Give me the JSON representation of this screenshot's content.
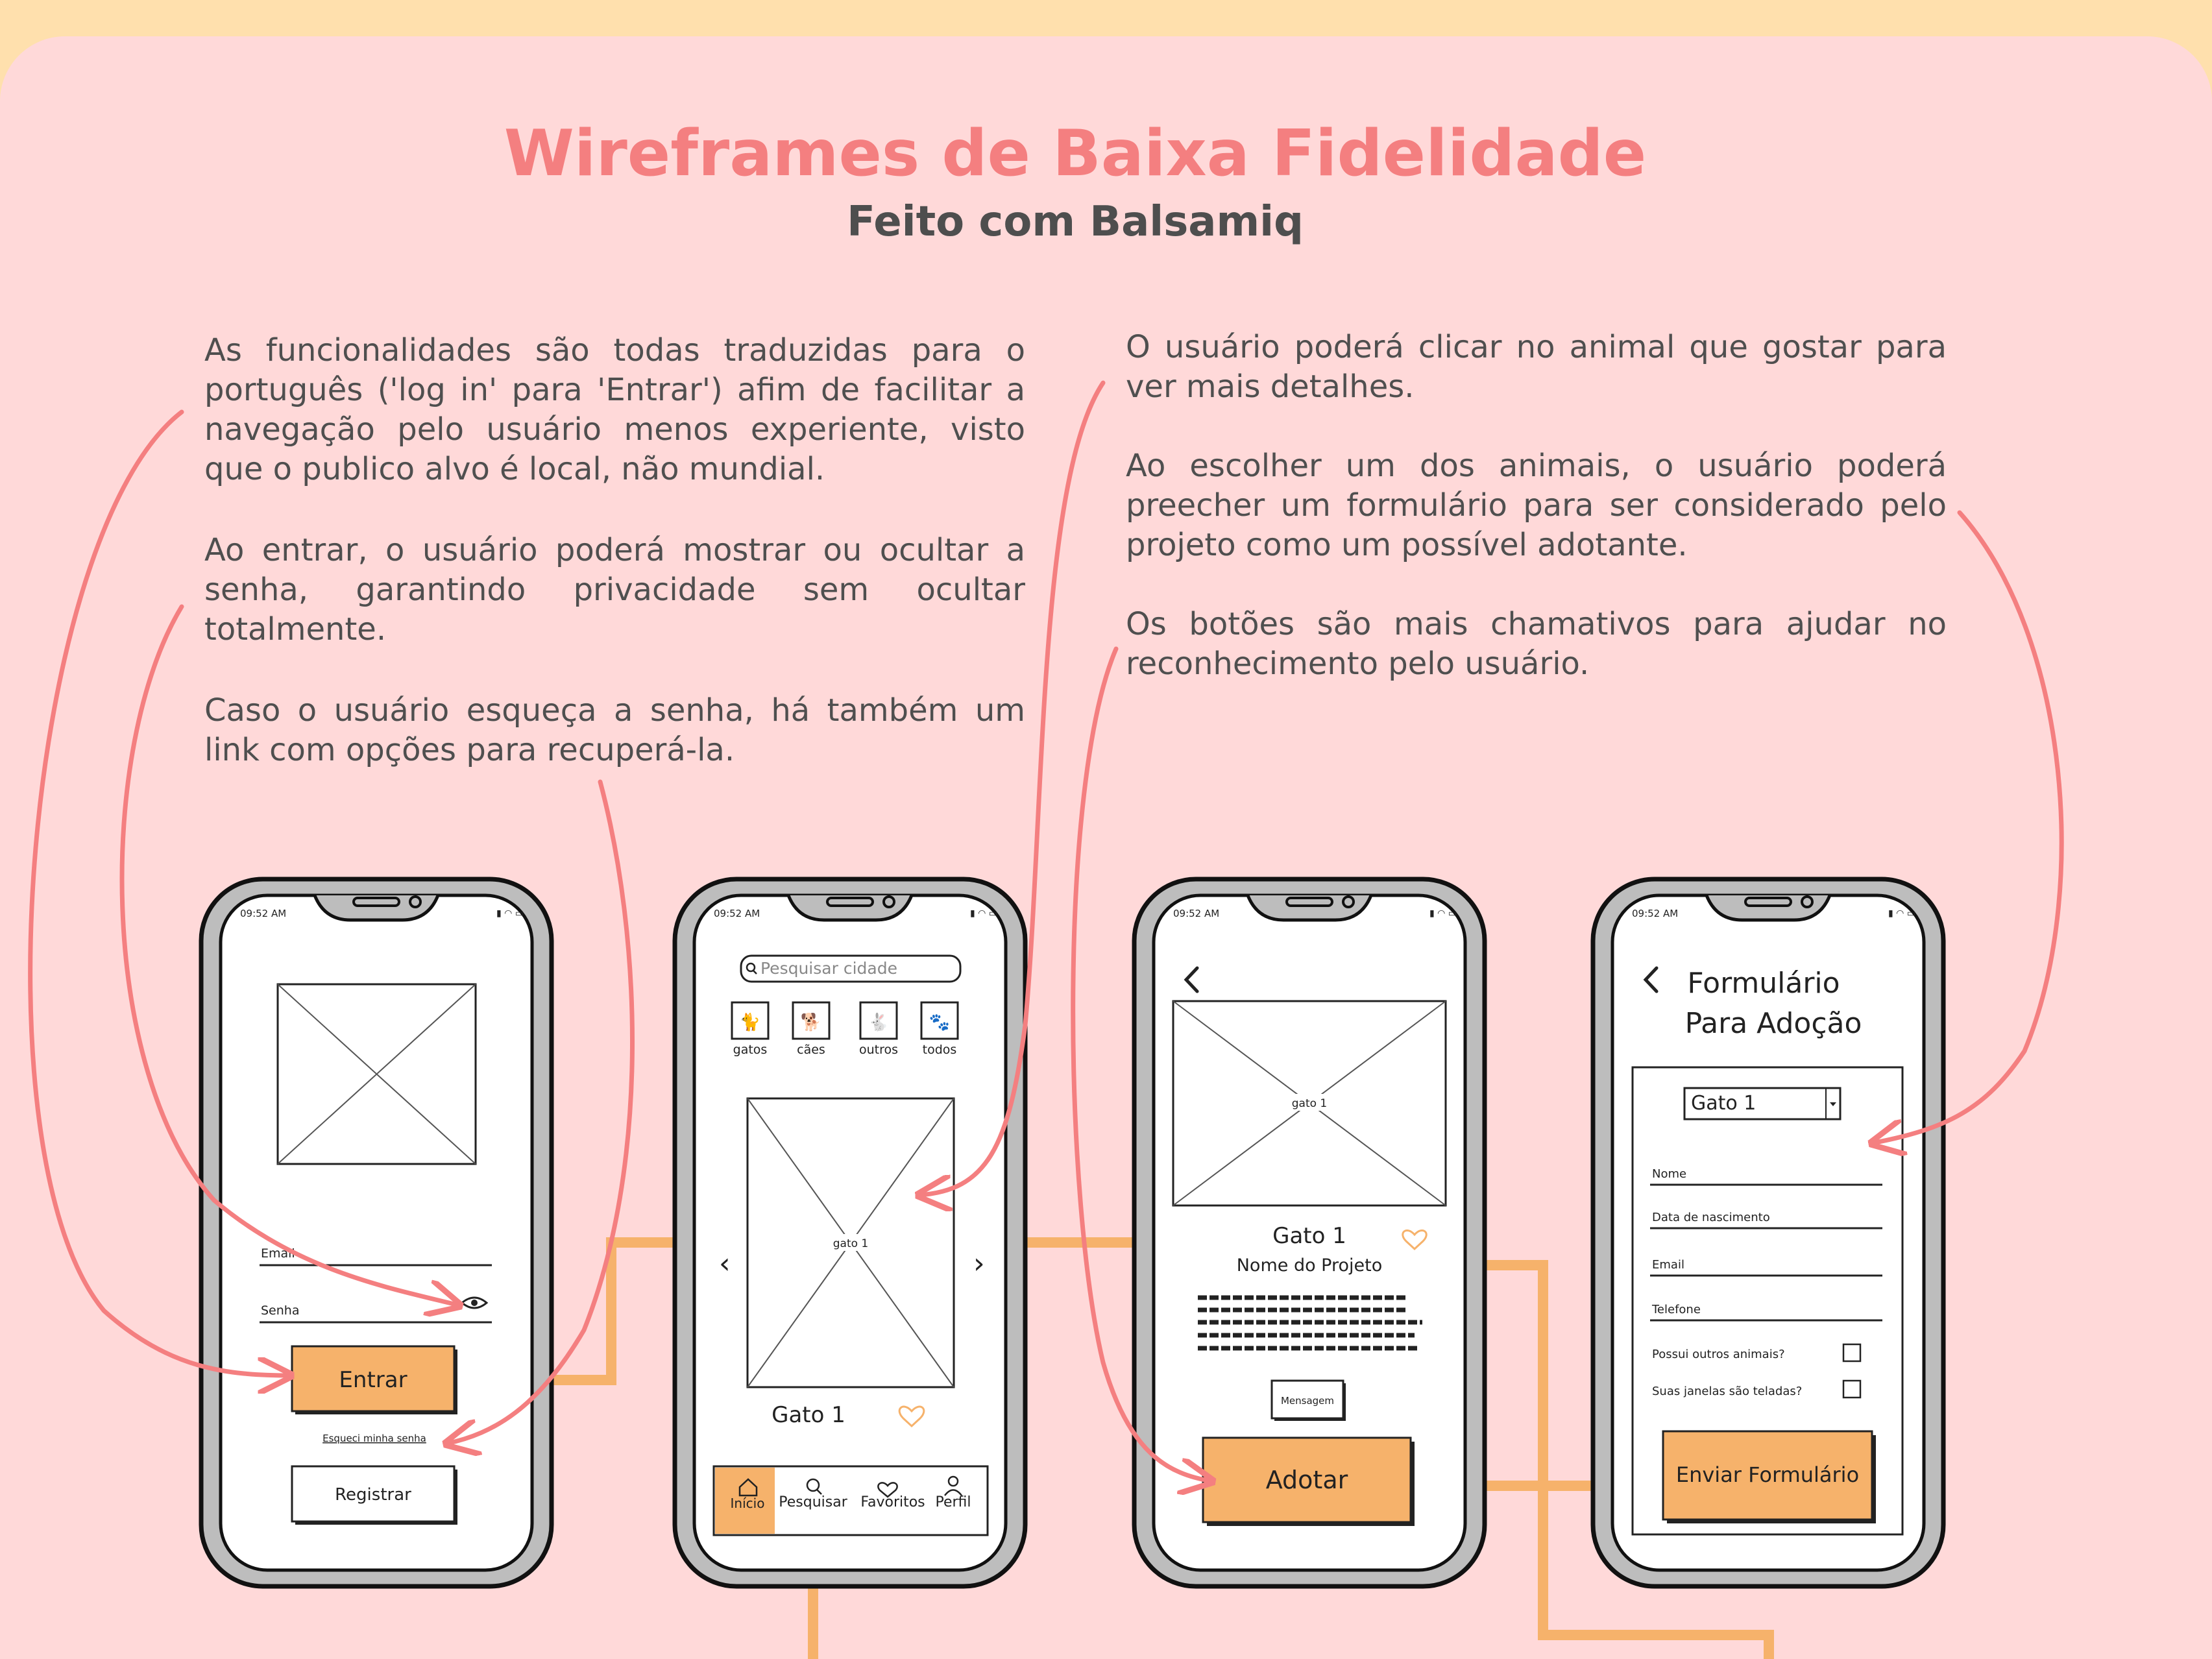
{
  "header": {
    "title": "Wireframes de Baixa Fidelidade",
    "subtitle": "Feito com Balsamiq"
  },
  "notes_left": {
    "p1": "As funcionalidades são todas traduzidas para o português ('log in' para 'Entrar') afim de facilitar a navegação pelo usuário menos experiente, visto que o publico alvo é local, não mundial.",
    "p2": "Ao entrar, o usuário poderá mostrar ou ocultar a senha, garantindo privacidade sem ocultar totalmente.",
    "p3": "Caso o usuário esqueça a senha, há também um link com opções para recuperá-la."
  },
  "notes_right": {
    "p1": "O usuário poderá clicar no animal que gostar para ver mais detalhes.",
    "p2": "Ao escolher um dos animais, o usuário poderá preecher um formulário para ser considerado pelo projeto como um possível adotante.",
    "p3": "Os botões são mais chamativos para ajudar no reconhecimento pelo usuário."
  },
  "status_time": "09:52 AM",
  "screen_login": {
    "email_label": "Email",
    "password_label": "Senha",
    "login_button": "Entrar",
    "forgot_link": "Esqueci minha senha",
    "register_button": "Registrar"
  },
  "screen_home": {
    "search_placeholder": "Pesquisar cidade",
    "categories": [
      "gatos",
      "cães",
      "outros",
      "todos"
    ],
    "image_caption": "gato 1",
    "card_title": "Gato 1",
    "nav": [
      "Início",
      "Pesquisar",
      "Favoritos",
      "Perfil"
    ]
  },
  "screen_detail": {
    "image_caption": "gato 1",
    "name": "Gato 1",
    "project": "Nome do Projeto",
    "message_button": "Mensagem",
    "adopt_button": "Adotar"
  },
  "screen_form": {
    "title_line1": "Formulário",
    "title_line2": "Para Adoção",
    "select_value": "Gato 1",
    "fields": [
      "Nome",
      "Data de nascimento",
      "Email",
      "Telefone"
    ],
    "checks": [
      "Possui outros animais?",
      "Suas janelas são teladas?"
    ],
    "submit_button": "Enviar Formulário"
  },
  "colors": {
    "accent_orange": "#f6b26b",
    "arrow_coral": "#f47f80",
    "board_pink": "#ffd9d9",
    "top_band": "#ffe0ad"
  }
}
